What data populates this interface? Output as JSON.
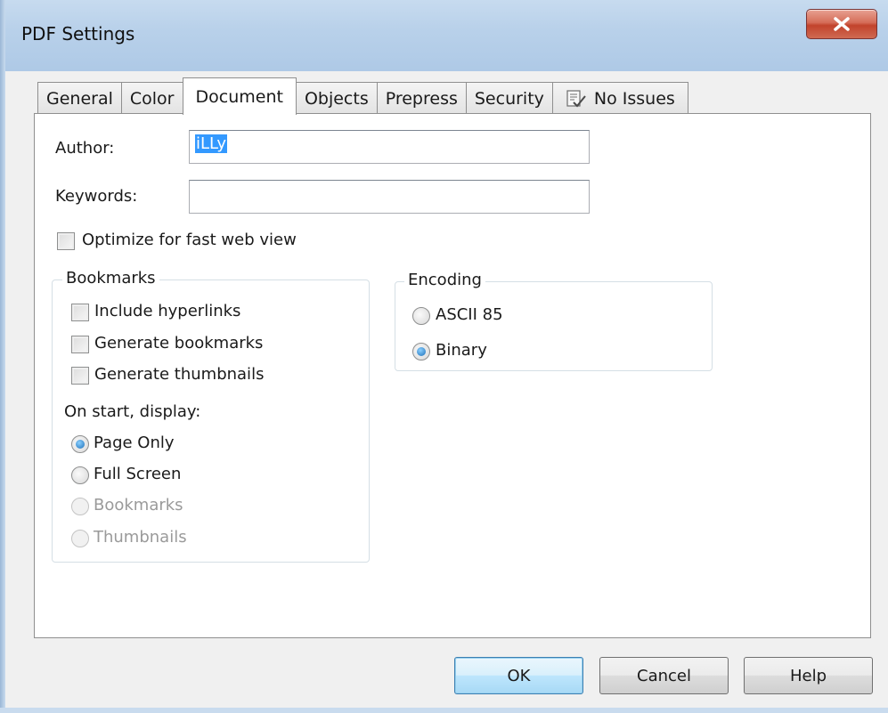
{
  "window": {
    "title": "PDF Settings",
    "close_label": "x"
  },
  "tabs": [
    {
      "label": "General",
      "active": false
    },
    {
      "label": "Color",
      "active": false
    },
    {
      "label": "Document",
      "active": true
    },
    {
      "label": "Objects",
      "active": false
    },
    {
      "label": "Prepress",
      "active": false
    },
    {
      "label": "Security",
      "active": false
    },
    {
      "label": "No Issues",
      "active": false,
      "icon": "checklist-icon"
    }
  ],
  "document": {
    "author_label": "Author:",
    "author_value": "iLLy",
    "keywords_label": "Keywords:",
    "keywords_value": "",
    "fast_web_view_label": "Optimize for fast web view",
    "fast_web_view_checked": false
  },
  "bookmarks": {
    "title": "Bookmarks",
    "include_hyperlinks": {
      "label": "Include hyperlinks",
      "checked": false
    },
    "generate_bookmarks": {
      "label": "Generate bookmarks",
      "checked": false
    },
    "generate_thumbnails": {
      "label": "Generate thumbnails",
      "checked": false
    },
    "on_start_label": "On start, display:",
    "display_options": [
      {
        "label": "Page Only",
        "selected": true,
        "enabled": true
      },
      {
        "label": "Full Screen",
        "selected": false,
        "enabled": true
      },
      {
        "label": "Bookmarks",
        "selected": false,
        "enabled": false
      },
      {
        "label": "Thumbnails",
        "selected": false,
        "enabled": false
      }
    ]
  },
  "encoding": {
    "title": "Encoding",
    "options": [
      {
        "label": "ASCII 85",
        "selected": false
      },
      {
        "label": "Binary",
        "selected": true
      }
    ]
  },
  "buttons": {
    "ok": "OK",
    "cancel": "Cancel",
    "help": "Help"
  },
  "colors": {
    "selection": "#3399ff",
    "default_button_border": "#3c7fb1",
    "close_button": "#c2432c"
  }
}
